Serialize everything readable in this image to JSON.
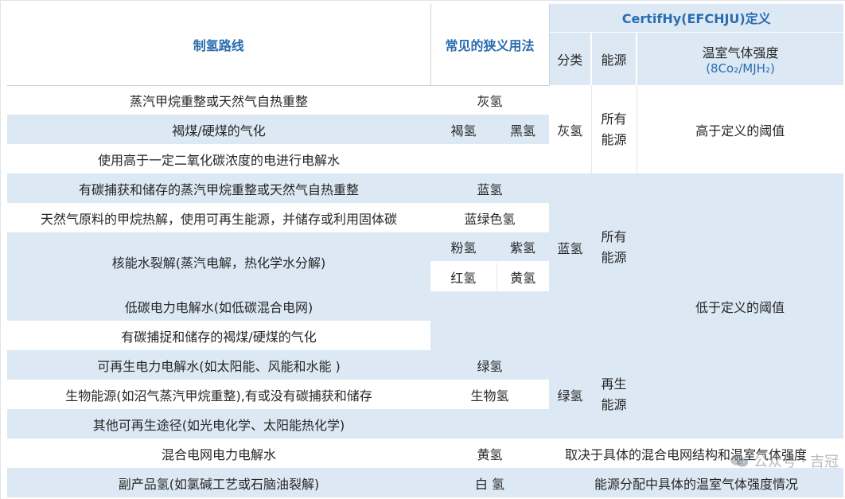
{
  "header": {
    "route": "制氢路线",
    "common": "常见的狭义用法",
    "certif": "CertifHy(EFCHJU)定义",
    "cls": "分类",
    "energy": "能源",
    "ghg": "温室气体强度",
    "ghg_unit": "(8Co₂/MJH₂)"
  },
  "rows": [
    "蒸汽甲烷重整或天然气自热重整",
    "褐煤/硬煤的气化",
    "使用高于一定二氧化碳浓度的电进行电解水",
    "有碳捕获和储存的蒸汽甲烷重整或天然气自热重整",
    "天然气原料的甲烷热解，使用可再生能源，并储存或利用固体碳",
    "核能水裂解(蒸汽电解，热化学水分解)",
    "低碳电力电解水(如低碳混合电网)",
    "有碳捕捉和储存的褐煤/硬煤的气化",
    "可再生电力电解水(如太阳能、风能和水能 )",
    "生物能源(如沼气蒸汽甲烷重整),有或没有碳捕获和储存",
    "其他可再生途径(如光电化学、太阳能热化学)",
    "混合电网电力电解水",
    "副产品氢(如氯碱工艺或石脑油裂解)"
  ],
  "names": {
    "grey": "灰氢",
    "brown": "褐氢",
    "black": "黑氢",
    "blue": "蓝氢",
    "turquoise": "蓝绿色氢",
    "pink": "粉氢",
    "purple": "紫氢",
    "red": "红氢",
    "yellow": "黄氢",
    "green": "绿氢",
    "bio": "生物氢",
    "yellow2": "黄氢",
    "white": "白 氢"
  },
  "certif": {
    "grey_cls": "灰氢",
    "grey_energy": "所有能源",
    "grey_ghg": "高于定义的阈值",
    "blue_cls": "蓝氢",
    "blue_energy": "所有能源",
    "low_ghg": "低于定义的阈值",
    "green_cls": "绿氢",
    "green_energy": "再生能源",
    "mixed_note": "取决于具体的混合电网结构和温室气体强度",
    "byproduct_note": "能源分配中具体的温室气体强度情况"
  },
  "watermark": "公众号 · 吉冠",
  "colors": {
    "header_text": "#2a6db0",
    "band": "#dce9f4"
  }
}
